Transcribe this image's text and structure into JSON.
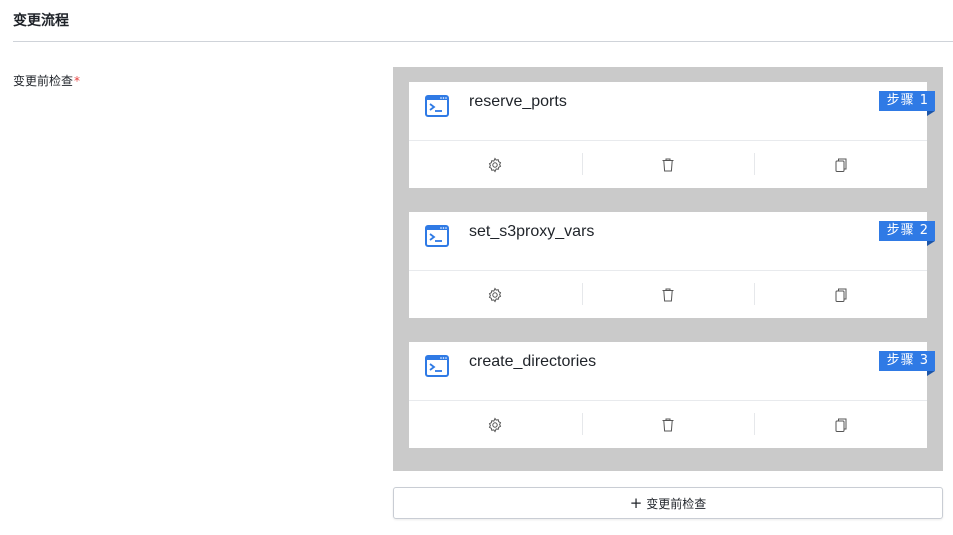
{
  "section": {
    "title": "变更流程"
  },
  "field": {
    "label": "变更前检查",
    "required_mark": "*"
  },
  "steps": [
    {
      "name": "reserve_ports",
      "badge": "步骤 1"
    },
    {
      "name": "set_s3proxy_vars",
      "badge": "步骤 2"
    },
    {
      "name": "create_directories",
      "badge": "步骤 3"
    }
  ],
  "icons": {
    "step_icon": "terminal-icon",
    "actions": [
      "gear-icon",
      "trash-icon",
      "copy-icon"
    ]
  },
  "add_button": {
    "plus": "+",
    "label": "变更前检查"
  },
  "colors": {
    "accent": "#2f7ae5",
    "panel_bg": "#cacaca",
    "required": "#e5413f"
  }
}
